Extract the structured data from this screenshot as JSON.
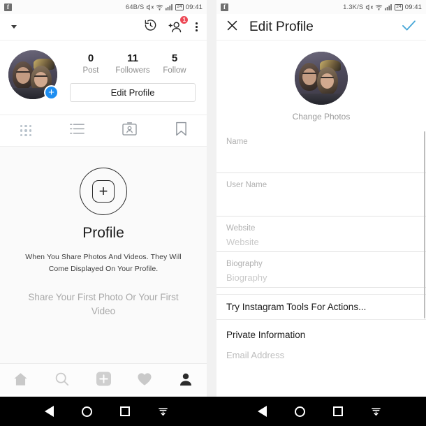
{
  "status_bar": {
    "left": {
      "notification_icon": "facebook-icon",
      "network_speed": "64B/S",
      "mute_icon": "mute-icon",
      "wifi_icon": "wifi-icon",
      "signal_icon": "signal-icon",
      "battery_level": "24",
      "time": "09:41"
    },
    "right": {
      "notification_icon": "facebook-icon",
      "network_speed": "1.3K/S",
      "mute_icon": "mute-icon",
      "wifi_icon": "wifi-icon",
      "signal_icon": "signal-icon",
      "battery_level": "24",
      "time": "09:41"
    }
  },
  "left_panel": {
    "toolbar": {
      "username": "",
      "caret_icon": "chevron-down-icon",
      "history_icon": "history-clock-icon",
      "add_person_icon": "add-person-icon",
      "add_person_badge": "1",
      "overflow_icon": "more-vertical-icon"
    },
    "profile": {
      "avatar_name": "profile-avatar",
      "add_story_badge": "+",
      "stats": [
        {
          "value": "0",
          "label": "Post"
        },
        {
          "value": "11",
          "label": "Followers"
        },
        {
          "value": "5",
          "label": "Follow"
        }
      ],
      "edit_profile_button": "Edit Profile"
    },
    "tabs": [
      {
        "name": "tab-grid",
        "icon": "grid-icon",
        "active": true
      },
      {
        "name": "tab-list",
        "icon": "list-icon",
        "active": false
      },
      {
        "name": "tab-tagged",
        "icon": "tagged-person-icon",
        "active": false
      },
      {
        "name": "tab-saved",
        "icon": "bookmark-icon",
        "active": false
      }
    ],
    "empty_state": {
      "add_icon": "add-photo-circle-icon",
      "title": "Profile",
      "description": "When You Share Photos And Videos. They Will Come Displayed On Your Profile.",
      "cta": "Share Your First Photo Or Your First Video"
    },
    "bottom_nav": [
      {
        "name": "nav-home",
        "icon": "home-icon",
        "active": false
      },
      {
        "name": "nav-search",
        "icon": "search-icon",
        "active": false
      },
      {
        "name": "nav-add",
        "icon": "add-post-icon",
        "active": false
      },
      {
        "name": "nav-activity",
        "icon": "heart-icon",
        "active": false
      },
      {
        "name": "nav-profile",
        "icon": "person-icon",
        "active": true
      }
    ]
  },
  "right_panel": {
    "header": {
      "close_icon": "close-icon",
      "title": "Edit Profile",
      "confirm_icon": "checkmark-icon",
      "accent_color": "#4aa8d8"
    },
    "change_photo": {
      "avatar_name": "edit-profile-avatar",
      "label": "Change Photos"
    },
    "fields": [
      {
        "name": "name-field",
        "label": "Name",
        "value": "",
        "placeholder": ""
      },
      {
        "name": "username-field",
        "label": "User Name",
        "value": "",
        "placeholder": ""
      },
      {
        "name": "website-field",
        "label": "Website",
        "value": "Website",
        "placeholder": "Website"
      },
      {
        "name": "biography-field",
        "label": "Biography",
        "value": "Biography",
        "placeholder": "Biography"
      }
    ],
    "promo_row": "Try Instagram Tools For Actions...",
    "private_section": {
      "title": "Private Information",
      "email_placeholder": "Email Address"
    }
  },
  "android_nav": {
    "back_icon": "back-triangle-icon",
    "home_icon": "home-circle-icon",
    "recent_icon": "recent-square-icon",
    "hide_icon": "hide-navbar-icon"
  }
}
